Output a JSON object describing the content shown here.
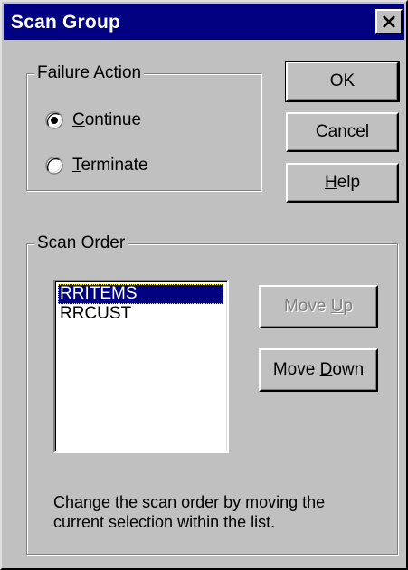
{
  "window": {
    "title": "Scan Group",
    "close_icon": "close-icon"
  },
  "failure_action": {
    "legend": "Failure Action",
    "options": [
      {
        "label_accel": "C",
        "label_rest": "ontinue",
        "selected": true
      },
      {
        "label_accel": "T",
        "label_rest": "erminate",
        "selected": false
      }
    ]
  },
  "buttons": {
    "ok": "OK",
    "cancel": "Cancel",
    "help_accel": "H",
    "help_rest": "elp"
  },
  "scan_order": {
    "legend": "Scan Order",
    "items": [
      "RRITEMS",
      "RRCUST"
    ],
    "selected_index": 0,
    "move_up_prefix": "Move ",
    "move_up_accel": "U",
    "move_up_rest": "p",
    "move_up_enabled": false,
    "move_down_prefix": "Move ",
    "move_down_accel": "D",
    "move_down_rest": "own",
    "move_down_enabled": true,
    "hint_line1": "Change the scan order by moving the",
    "hint_line2": "current selection within the list."
  },
  "colors": {
    "title_bar": "#000080",
    "face": "#c0c0c0",
    "selection": "#000080"
  }
}
